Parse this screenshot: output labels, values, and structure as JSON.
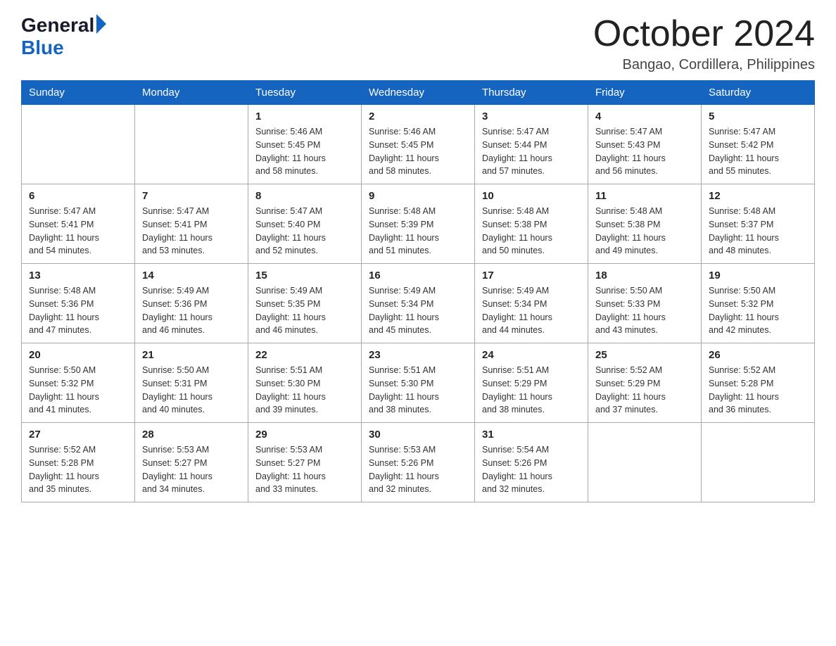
{
  "header": {
    "logo_general": "General",
    "logo_blue": "Blue",
    "month": "October 2024",
    "location": "Bangao, Cordillera, Philippines"
  },
  "days_of_week": [
    "Sunday",
    "Monday",
    "Tuesday",
    "Wednesday",
    "Thursday",
    "Friday",
    "Saturday"
  ],
  "weeks": [
    [
      {
        "day": "",
        "info": ""
      },
      {
        "day": "",
        "info": ""
      },
      {
        "day": "1",
        "info": "Sunrise: 5:46 AM\nSunset: 5:45 PM\nDaylight: 11 hours\nand 58 minutes."
      },
      {
        "day": "2",
        "info": "Sunrise: 5:46 AM\nSunset: 5:45 PM\nDaylight: 11 hours\nand 58 minutes."
      },
      {
        "day": "3",
        "info": "Sunrise: 5:47 AM\nSunset: 5:44 PM\nDaylight: 11 hours\nand 57 minutes."
      },
      {
        "day": "4",
        "info": "Sunrise: 5:47 AM\nSunset: 5:43 PM\nDaylight: 11 hours\nand 56 minutes."
      },
      {
        "day": "5",
        "info": "Sunrise: 5:47 AM\nSunset: 5:42 PM\nDaylight: 11 hours\nand 55 minutes."
      }
    ],
    [
      {
        "day": "6",
        "info": "Sunrise: 5:47 AM\nSunset: 5:41 PM\nDaylight: 11 hours\nand 54 minutes."
      },
      {
        "day": "7",
        "info": "Sunrise: 5:47 AM\nSunset: 5:41 PM\nDaylight: 11 hours\nand 53 minutes."
      },
      {
        "day": "8",
        "info": "Sunrise: 5:47 AM\nSunset: 5:40 PM\nDaylight: 11 hours\nand 52 minutes."
      },
      {
        "day": "9",
        "info": "Sunrise: 5:48 AM\nSunset: 5:39 PM\nDaylight: 11 hours\nand 51 minutes."
      },
      {
        "day": "10",
        "info": "Sunrise: 5:48 AM\nSunset: 5:38 PM\nDaylight: 11 hours\nand 50 minutes."
      },
      {
        "day": "11",
        "info": "Sunrise: 5:48 AM\nSunset: 5:38 PM\nDaylight: 11 hours\nand 49 minutes."
      },
      {
        "day": "12",
        "info": "Sunrise: 5:48 AM\nSunset: 5:37 PM\nDaylight: 11 hours\nand 48 minutes."
      }
    ],
    [
      {
        "day": "13",
        "info": "Sunrise: 5:48 AM\nSunset: 5:36 PM\nDaylight: 11 hours\nand 47 minutes."
      },
      {
        "day": "14",
        "info": "Sunrise: 5:49 AM\nSunset: 5:36 PM\nDaylight: 11 hours\nand 46 minutes."
      },
      {
        "day": "15",
        "info": "Sunrise: 5:49 AM\nSunset: 5:35 PM\nDaylight: 11 hours\nand 46 minutes."
      },
      {
        "day": "16",
        "info": "Sunrise: 5:49 AM\nSunset: 5:34 PM\nDaylight: 11 hours\nand 45 minutes."
      },
      {
        "day": "17",
        "info": "Sunrise: 5:49 AM\nSunset: 5:34 PM\nDaylight: 11 hours\nand 44 minutes."
      },
      {
        "day": "18",
        "info": "Sunrise: 5:50 AM\nSunset: 5:33 PM\nDaylight: 11 hours\nand 43 minutes."
      },
      {
        "day": "19",
        "info": "Sunrise: 5:50 AM\nSunset: 5:32 PM\nDaylight: 11 hours\nand 42 minutes."
      }
    ],
    [
      {
        "day": "20",
        "info": "Sunrise: 5:50 AM\nSunset: 5:32 PM\nDaylight: 11 hours\nand 41 minutes."
      },
      {
        "day": "21",
        "info": "Sunrise: 5:50 AM\nSunset: 5:31 PM\nDaylight: 11 hours\nand 40 minutes."
      },
      {
        "day": "22",
        "info": "Sunrise: 5:51 AM\nSunset: 5:30 PM\nDaylight: 11 hours\nand 39 minutes."
      },
      {
        "day": "23",
        "info": "Sunrise: 5:51 AM\nSunset: 5:30 PM\nDaylight: 11 hours\nand 38 minutes."
      },
      {
        "day": "24",
        "info": "Sunrise: 5:51 AM\nSunset: 5:29 PM\nDaylight: 11 hours\nand 38 minutes."
      },
      {
        "day": "25",
        "info": "Sunrise: 5:52 AM\nSunset: 5:29 PM\nDaylight: 11 hours\nand 37 minutes."
      },
      {
        "day": "26",
        "info": "Sunrise: 5:52 AM\nSunset: 5:28 PM\nDaylight: 11 hours\nand 36 minutes."
      }
    ],
    [
      {
        "day": "27",
        "info": "Sunrise: 5:52 AM\nSunset: 5:28 PM\nDaylight: 11 hours\nand 35 minutes."
      },
      {
        "day": "28",
        "info": "Sunrise: 5:53 AM\nSunset: 5:27 PM\nDaylight: 11 hours\nand 34 minutes."
      },
      {
        "day": "29",
        "info": "Sunrise: 5:53 AM\nSunset: 5:27 PM\nDaylight: 11 hours\nand 33 minutes."
      },
      {
        "day": "30",
        "info": "Sunrise: 5:53 AM\nSunset: 5:26 PM\nDaylight: 11 hours\nand 32 minutes."
      },
      {
        "day": "31",
        "info": "Sunrise: 5:54 AM\nSunset: 5:26 PM\nDaylight: 11 hours\nand 32 minutes."
      },
      {
        "day": "",
        "info": ""
      },
      {
        "day": "",
        "info": ""
      }
    ]
  ]
}
